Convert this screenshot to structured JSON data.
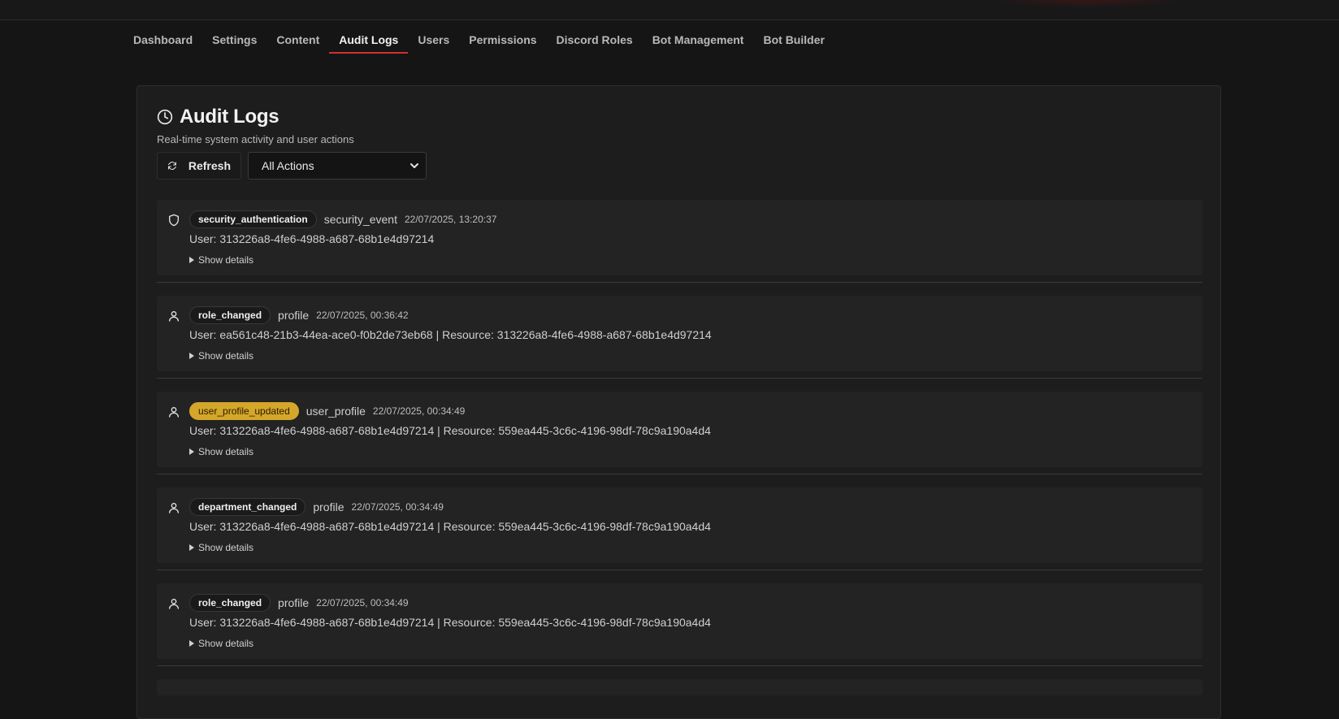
{
  "nav": {
    "items": [
      "Dashboard",
      "Settings",
      "Content",
      "Audit Logs",
      "Users",
      "Permissions",
      "Discord Roles",
      "Bot Management",
      "Bot Builder"
    ],
    "active": "Audit Logs"
  },
  "header": {
    "title": "Audit Logs",
    "subtitle": "Real-time system activity and user actions",
    "icon": "clock-icon"
  },
  "controls": {
    "refresh_label": "Refresh",
    "refresh_icon": "refresh-icon",
    "filter_value": "All Actions"
  },
  "colors": {
    "accent": "#d32f2f",
    "badge_warning": "#d4a62a",
    "background": "#151515",
    "panel": "#1d1d1d"
  },
  "logs": [
    {
      "icon": "shield-icon",
      "action": "security_authentication",
      "highlight": false,
      "resource_type": "security_event",
      "timestamp": "22/07/2025, 13:20:37",
      "description": "User: 313226a8-4fe6-4988-a687-68b1e4d97214",
      "details_label": "Show details"
    },
    {
      "icon": "user-icon",
      "action": "role_changed",
      "highlight": false,
      "resource_type": "profile",
      "timestamp": "22/07/2025, 00:36:42",
      "description": "User: ea561c48-21b3-44ea-ace0-f0b2de73eb68 | Resource: 313226a8-4fe6-4988-a687-68b1e4d97214",
      "details_label": "Show details"
    },
    {
      "icon": "user-icon",
      "action": "user_profile_updated",
      "highlight": true,
      "resource_type": "user_profile",
      "timestamp": "22/07/2025, 00:34:49",
      "description": "User: 313226a8-4fe6-4988-a687-68b1e4d97214 | Resource: 559ea445-3c6c-4196-98df-78c9a190a4d4",
      "details_label": "Show details"
    },
    {
      "icon": "user-icon",
      "action": "department_changed",
      "highlight": false,
      "resource_type": "profile",
      "timestamp": "22/07/2025, 00:34:49",
      "description": "User: 313226a8-4fe6-4988-a687-68b1e4d97214 | Resource: 559ea445-3c6c-4196-98df-78c9a190a4d4",
      "details_label": "Show details"
    },
    {
      "icon": "user-icon",
      "action": "role_changed",
      "highlight": false,
      "resource_type": "profile",
      "timestamp": "22/07/2025, 00:34:49",
      "description": "User: 313226a8-4fe6-4988-a687-68b1e4d97214 | Resource: 559ea445-3c6c-4196-98df-78c9a190a4d4",
      "details_label": "Show details"
    }
  ]
}
